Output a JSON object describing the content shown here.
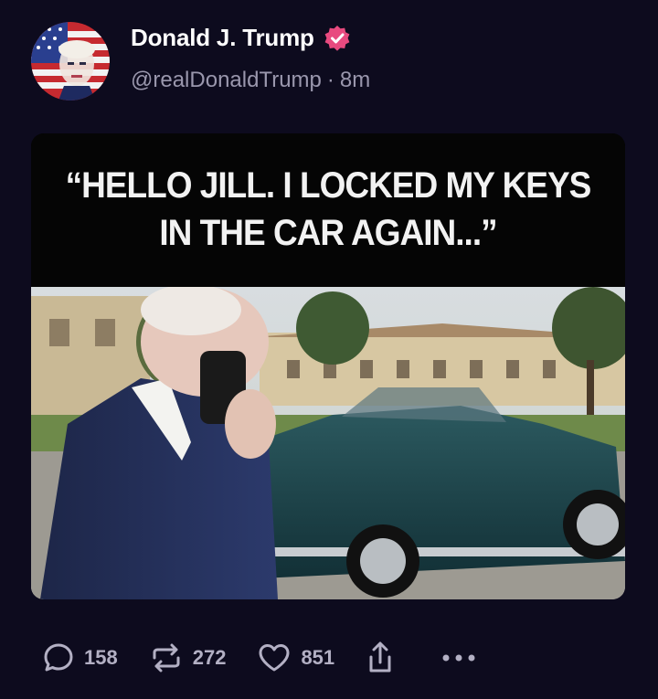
{
  "post": {
    "author": {
      "display_name": "Donald J. Trump",
      "handle": "@realDonaldTrump",
      "separator": "·",
      "time_ago": "8m",
      "verified_icon": "verified-badge-icon",
      "verified_color": "#e84a7f"
    },
    "media": {
      "caption_line1": "“HELLO JILL.  I LOCKED MY KEYS",
      "caption_line2": "IN THE CAR AGAIN...”"
    },
    "actions": {
      "reply": {
        "icon": "reply-icon",
        "count": "158"
      },
      "repost": {
        "icon": "repost-icon",
        "count": "272"
      },
      "like": {
        "icon": "heart-icon",
        "count": "851"
      },
      "share": {
        "icon": "share-icon"
      },
      "more": {
        "icon": "more-icon"
      }
    }
  },
  "colors": {
    "background": "#0d0b1e",
    "muted_text": "#9a97ad",
    "action_color": "#b3b0c4"
  }
}
